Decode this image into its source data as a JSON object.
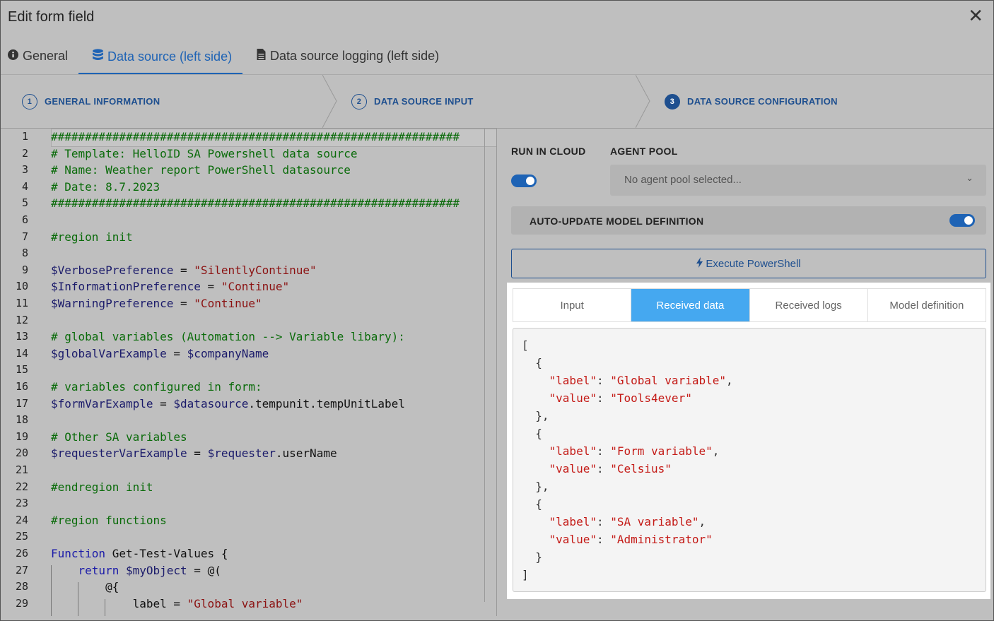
{
  "dialog": {
    "title": "Edit form field",
    "close_glyph": "✕"
  },
  "tabs": [
    {
      "label": "General",
      "icon": "info-icon"
    },
    {
      "label": "Data source (left side)",
      "icon": "database-icon"
    },
    {
      "label": "Data source logging (left side)",
      "icon": "file-icon"
    }
  ],
  "steps": [
    {
      "num": "1",
      "label": "GENERAL INFORMATION"
    },
    {
      "num": "2",
      "label": "DATA SOURCE INPUT"
    },
    {
      "num": "3",
      "label": "DATA SOURCE CONFIGURATION"
    }
  ],
  "editor": {
    "lines": [
      "############################################################",
      "# Template: HelloID SA Powershell data source",
      "# Name: Weather report PowerShell datasource",
      "# Date: 8.7.2023",
      "############################################################",
      "",
      "#region init",
      "",
      "$VerbosePreference = \"SilentlyContinue\"",
      "$InformationPreference = \"Continue\"",
      "$WarningPreference = \"Continue\"",
      "",
      "# global variables (Automation --> Variable libary):",
      "$globalVarExample = $companyName",
      "",
      "# variables configured in form:",
      "$formVarExample = $datasource.tempunit.tempUnitLabel",
      "",
      "# Other SA variables",
      "$requesterVarExample = $requester.userName",
      "",
      "#endregion init",
      "",
      "#region functions",
      "",
      "Function Get-Test-Values {",
      "    return $myObject = @(",
      "        @{",
      "            label = \"Global variable\""
    ]
  },
  "right": {
    "run_in_cloud_label": "RUN IN CLOUD",
    "agent_pool_label": "AGENT POOL",
    "agent_pool_placeholder": "No agent pool selected...",
    "auto_update_label": "AUTO-UPDATE MODEL DEFINITION",
    "execute_label": "Execute PowerShell",
    "result_tabs": [
      "Input",
      "Received data",
      "Received logs",
      "Model definition"
    ],
    "json_lines": [
      "[",
      "  {",
      "    \"label\": \"Global variable\",",
      "    \"value\": \"Tools4ever\"",
      "  },",
      "  {",
      "    \"label\": \"Form variable\",",
      "    \"value\": \"Celsius\"",
      "  },",
      "  {",
      "    \"label\": \"SA variable\",",
      "    \"value\": \"Administrator\"",
      "  }",
      "]"
    ]
  },
  "colors": {
    "accent": "#1e63b5",
    "active_tab": "#45a8f0",
    "comment": "#0a6b0a",
    "string": "#8b1111"
  }
}
